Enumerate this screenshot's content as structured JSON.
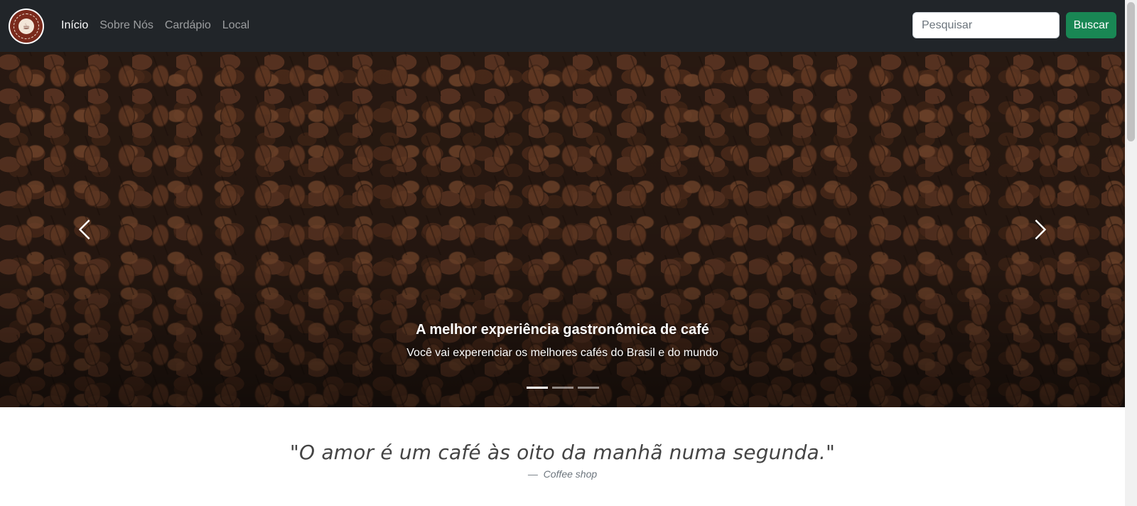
{
  "navbar": {
    "logo_label": "Coffee Shop",
    "links": [
      {
        "label": "Início",
        "active": true
      },
      {
        "label": "Sobre Nós",
        "active": false
      },
      {
        "label": "Cardápio",
        "active": false
      },
      {
        "label": "Local",
        "active": false
      }
    ],
    "search": {
      "placeholder": "Pesquisar",
      "value": ""
    },
    "search_button": "Buscar"
  },
  "carousel": {
    "slide": {
      "title": "A melhor experiência gastronômica de café",
      "subtitle": "Você vai experenciar os melhores cafés do Brasil e do mundo"
    },
    "indicators": 3,
    "active_index": 0
  },
  "quote": {
    "text": "\"O amor é um café às oito da manhã numa segunda.\"",
    "dash": "—",
    "source": "Coffee shop"
  },
  "colors": {
    "navbar_bg": "#212529",
    "button_green": "#198754"
  }
}
